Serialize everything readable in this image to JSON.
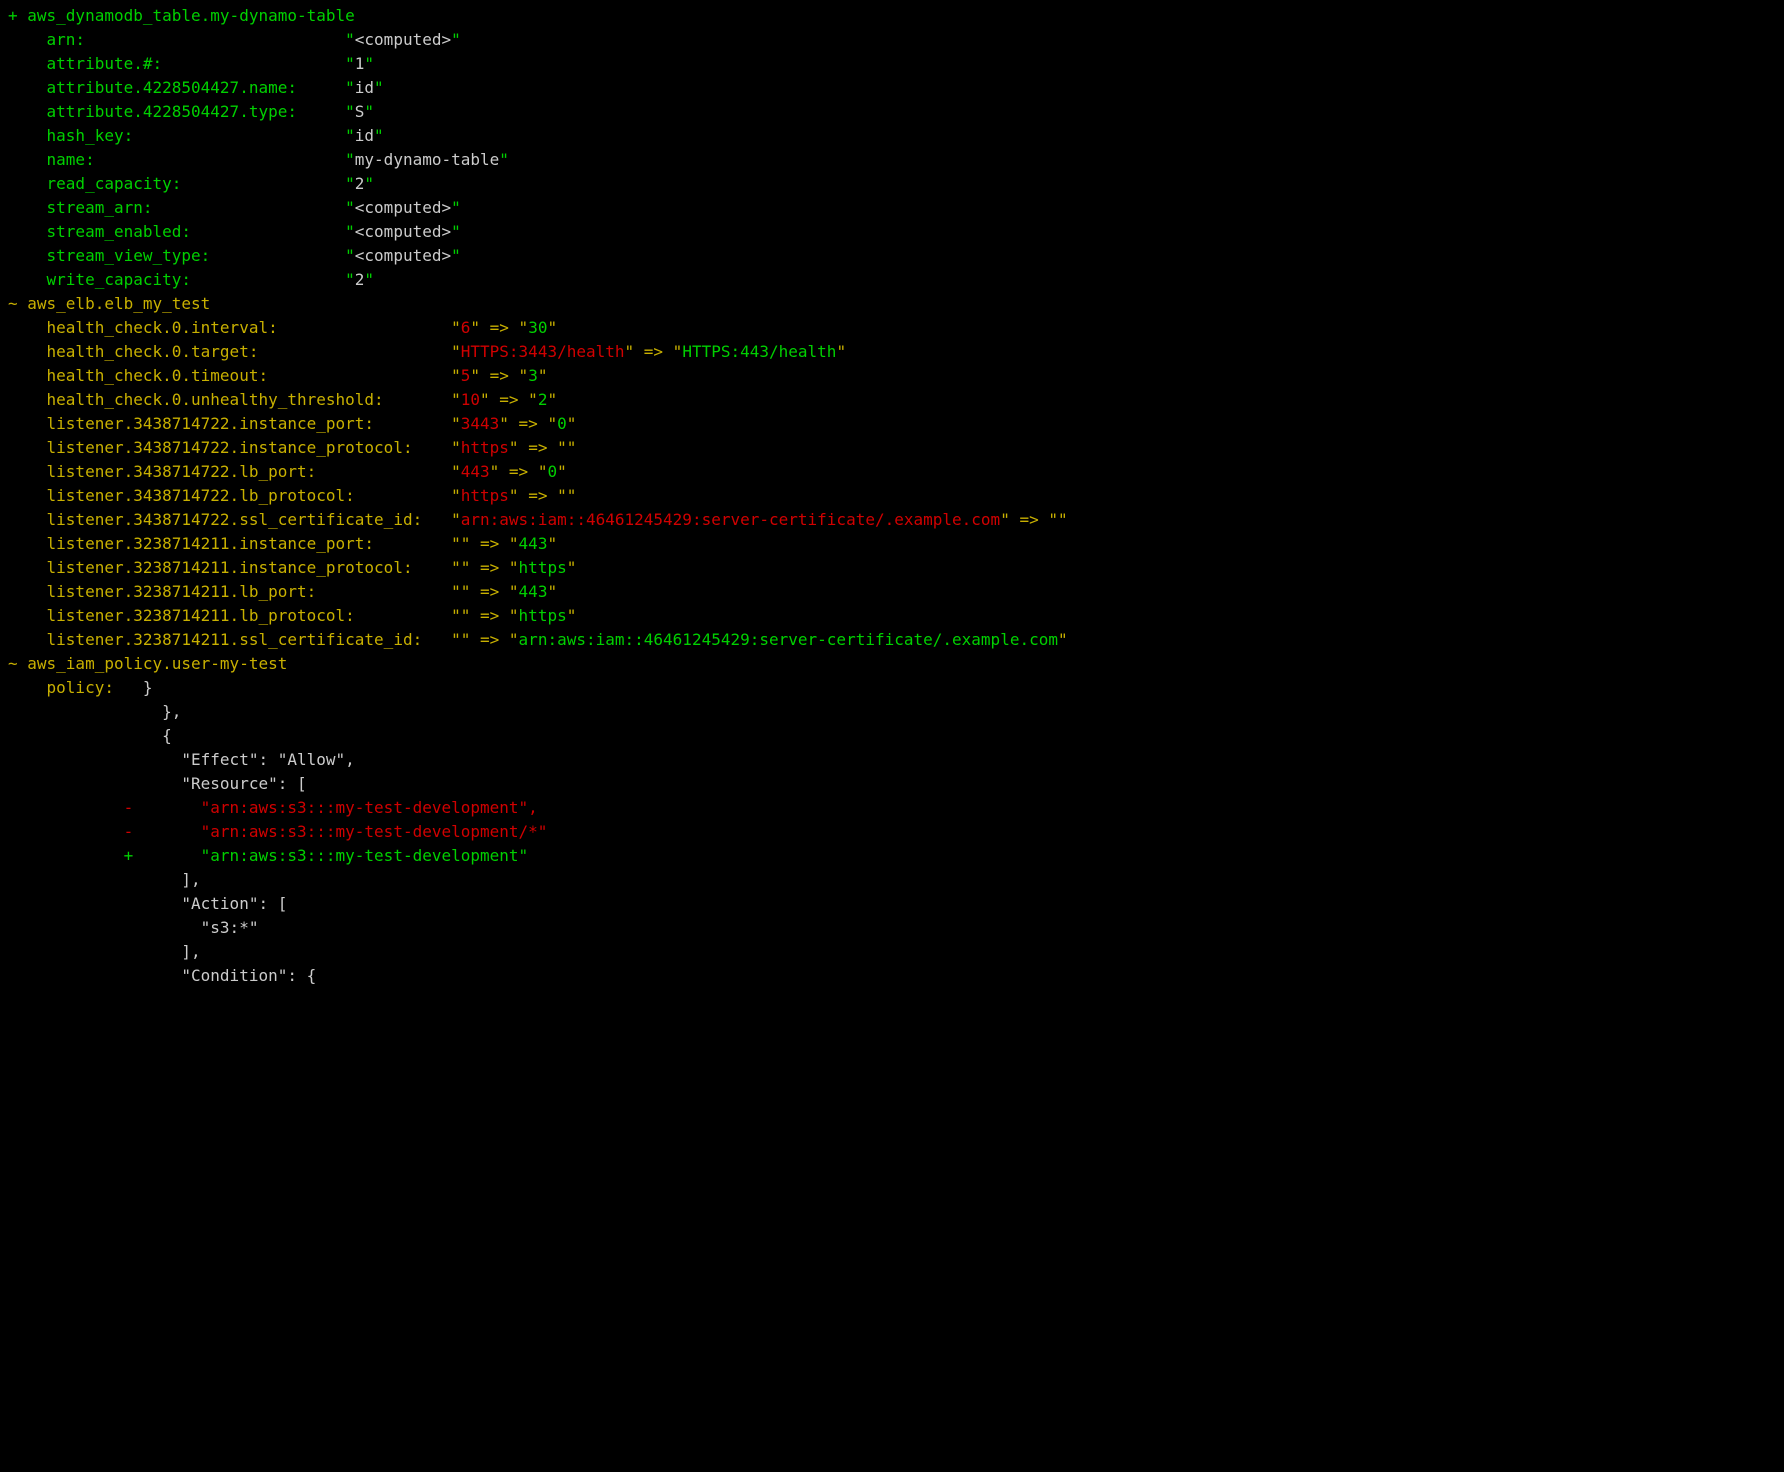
{
  "colors": {
    "bg": "#000000",
    "green": "#00d000",
    "yellow": "#c8b000",
    "red": "#d00000",
    "white": "#cccccc"
  },
  "lines": [
    {
      "segs": [
        {
          "c": "g",
          "t": "+ aws_dynamodb_table.my-dynamo-table"
        }
      ]
    },
    {
      "segs": [
        {
          "c": "g",
          "t": "    arn:                           \""
        },
        {
          "c": "w",
          "t": "<computed>"
        },
        {
          "c": "g",
          "t": "\""
        }
      ]
    },
    {
      "segs": [
        {
          "c": "g",
          "t": "    attribute.#:                   \""
        },
        {
          "c": "w",
          "t": "1"
        },
        {
          "c": "g",
          "t": "\""
        }
      ]
    },
    {
      "segs": [
        {
          "c": "g",
          "t": "    attribute.4228504427.name:     \""
        },
        {
          "c": "w",
          "t": "id"
        },
        {
          "c": "g",
          "t": "\""
        }
      ]
    },
    {
      "segs": [
        {
          "c": "g",
          "t": "    attribute.4228504427.type:     \""
        },
        {
          "c": "w",
          "t": "S"
        },
        {
          "c": "g",
          "t": "\""
        }
      ]
    },
    {
      "segs": [
        {
          "c": "g",
          "t": "    hash_key:                      \""
        },
        {
          "c": "w",
          "t": "id"
        },
        {
          "c": "g",
          "t": "\""
        }
      ]
    },
    {
      "segs": [
        {
          "c": "g",
          "t": "    name:                          \""
        },
        {
          "c": "w",
          "t": "my-dynamo-table"
        },
        {
          "c": "g",
          "t": "\""
        }
      ]
    },
    {
      "segs": [
        {
          "c": "g",
          "t": "    read_capacity:                 \""
        },
        {
          "c": "w",
          "t": "2"
        },
        {
          "c": "g",
          "t": "\""
        }
      ]
    },
    {
      "segs": [
        {
          "c": "g",
          "t": "    stream_arn:                    \""
        },
        {
          "c": "w",
          "t": "<computed>"
        },
        {
          "c": "g",
          "t": "\""
        }
      ]
    },
    {
      "segs": [
        {
          "c": "g",
          "t": "    stream_enabled:                \""
        },
        {
          "c": "w",
          "t": "<computed>"
        },
        {
          "c": "g",
          "t": "\""
        }
      ]
    },
    {
      "segs": [
        {
          "c": "g",
          "t": "    stream_view_type:              \""
        },
        {
          "c": "w",
          "t": "<computed>"
        },
        {
          "c": "g",
          "t": "\""
        }
      ]
    },
    {
      "segs": [
        {
          "c": "g",
          "t": "    write_capacity:                \""
        },
        {
          "c": "w",
          "t": "2"
        },
        {
          "c": "g",
          "t": "\""
        }
      ]
    },
    {
      "segs": [
        {
          "c": "w",
          "t": ""
        }
      ]
    },
    {
      "segs": [
        {
          "c": "y",
          "t": "~ aws_elb.elb_my_test"
        }
      ]
    },
    {
      "segs": [
        {
          "c": "y",
          "t": "    health_check.0.interval:                  \""
        },
        {
          "c": "r",
          "t": "6"
        },
        {
          "c": "y",
          "t": "\" => \""
        },
        {
          "c": "g",
          "t": "30"
        },
        {
          "c": "y",
          "t": "\""
        }
      ]
    },
    {
      "segs": [
        {
          "c": "y",
          "t": "    health_check.0.target:                    \""
        },
        {
          "c": "r",
          "t": "HTTPS:3443/health"
        },
        {
          "c": "y",
          "t": "\" => \""
        },
        {
          "c": "g",
          "t": "HTTPS:443/health"
        },
        {
          "c": "y",
          "t": "\""
        }
      ]
    },
    {
      "segs": [
        {
          "c": "y",
          "t": "    health_check.0.timeout:                   \""
        },
        {
          "c": "r",
          "t": "5"
        },
        {
          "c": "y",
          "t": "\" => \""
        },
        {
          "c": "g",
          "t": "3"
        },
        {
          "c": "y",
          "t": "\""
        }
      ]
    },
    {
      "segs": [
        {
          "c": "y",
          "t": "    health_check.0.unhealthy_threshold:       \""
        },
        {
          "c": "r",
          "t": "10"
        },
        {
          "c": "y",
          "t": "\" => \""
        },
        {
          "c": "g",
          "t": "2"
        },
        {
          "c": "y",
          "t": "\""
        }
      ]
    },
    {
      "segs": [
        {
          "c": "y",
          "t": "    listener.3438714722.instance_port:        \""
        },
        {
          "c": "r",
          "t": "3443"
        },
        {
          "c": "y",
          "t": "\" => \""
        },
        {
          "c": "g",
          "t": "0"
        },
        {
          "c": "y",
          "t": "\""
        }
      ]
    },
    {
      "segs": [
        {
          "c": "y",
          "t": "    listener.3438714722.instance_protocol:    \""
        },
        {
          "c": "r",
          "t": "https"
        },
        {
          "c": "y",
          "t": "\" => \"\""
        }
      ]
    },
    {
      "segs": [
        {
          "c": "y",
          "t": "    listener.3438714722.lb_port:              \""
        },
        {
          "c": "r",
          "t": "443"
        },
        {
          "c": "y",
          "t": "\" => \""
        },
        {
          "c": "g",
          "t": "0"
        },
        {
          "c": "y",
          "t": "\""
        }
      ]
    },
    {
      "segs": [
        {
          "c": "y",
          "t": "    listener.3438714722.lb_protocol:          \""
        },
        {
          "c": "r",
          "t": "https"
        },
        {
          "c": "y",
          "t": "\" => \"\""
        }
      ]
    },
    {
      "segs": [
        {
          "c": "y",
          "t": "    listener.3438714722.ssl_certificate_id:   \""
        },
        {
          "c": "r",
          "t": "arn:aws:iam::46461245429:server-certificate/.example.com"
        },
        {
          "c": "y",
          "t": "\" => \"\""
        }
      ]
    },
    {
      "segs": [
        {
          "c": "y",
          "t": "    listener.3238714211.instance_port:        \"\" => \""
        },
        {
          "c": "g",
          "t": "443"
        },
        {
          "c": "y",
          "t": "\""
        }
      ]
    },
    {
      "segs": [
        {
          "c": "y",
          "t": "    listener.3238714211.instance_protocol:    \"\" => \""
        },
        {
          "c": "g",
          "t": "https"
        },
        {
          "c": "y",
          "t": "\""
        }
      ]
    },
    {
      "segs": [
        {
          "c": "y",
          "t": "    listener.3238714211.lb_port:              \"\" => \""
        },
        {
          "c": "g",
          "t": "443"
        },
        {
          "c": "y",
          "t": "\""
        }
      ]
    },
    {
      "segs": [
        {
          "c": "y",
          "t": "    listener.3238714211.lb_protocol:          \"\" => \""
        },
        {
          "c": "g",
          "t": "https"
        },
        {
          "c": "y",
          "t": "\""
        }
      ]
    },
    {
      "segs": [
        {
          "c": "y",
          "t": "    listener.3238714211.ssl_certificate_id:   \"\" => \""
        },
        {
          "c": "g",
          "t": "arn:aws:iam::46461245429:server-certificate/.example.com"
        },
        {
          "c": "y",
          "t": "\""
        }
      ]
    },
    {
      "segs": [
        {
          "c": "w",
          "t": ""
        }
      ]
    },
    {
      "segs": [
        {
          "c": "y",
          "t": "~ aws_iam_policy.user-my-test"
        }
      ]
    },
    {
      "segs": [
        {
          "c": "y",
          "t": "    policy:   "
        },
        {
          "c": "w",
          "t": "}"
        }
      ]
    },
    {
      "segs": [
        {
          "c": "w",
          "t": "                },"
        }
      ]
    },
    {
      "segs": [
        {
          "c": "w",
          "t": "                {"
        }
      ]
    },
    {
      "segs": [
        {
          "c": "w",
          "t": "                  \"Effect\": \"Allow\","
        }
      ]
    },
    {
      "segs": [
        {
          "c": "w",
          "t": "                  \"Resource\": ["
        }
      ]
    },
    {
      "segs": [
        {
          "c": "r",
          "t": "            -       \"arn:aws:s3:::my-test-development\","
        }
      ]
    },
    {
      "segs": [
        {
          "c": "r",
          "t": "            -       \"arn:aws:s3:::my-test-development/*\""
        }
      ]
    },
    {
      "segs": [
        {
          "c": "g",
          "t": "            +       \"arn:aws:s3:::my-test-development\""
        }
      ]
    },
    {
      "segs": [
        {
          "c": "w",
          "t": "                  ],"
        }
      ]
    },
    {
      "segs": [
        {
          "c": "w",
          "t": "                  \"Action\": ["
        }
      ]
    },
    {
      "segs": [
        {
          "c": "w",
          "t": "                    \"s3:*\""
        }
      ]
    },
    {
      "segs": [
        {
          "c": "w",
          "t": "                  ],"
        }
      ]
    },
    {
      "segs": [
        {
          "c": "w",
          "t": "                  \"Condition\": {"
        }
      ]
    }
  ]
}
